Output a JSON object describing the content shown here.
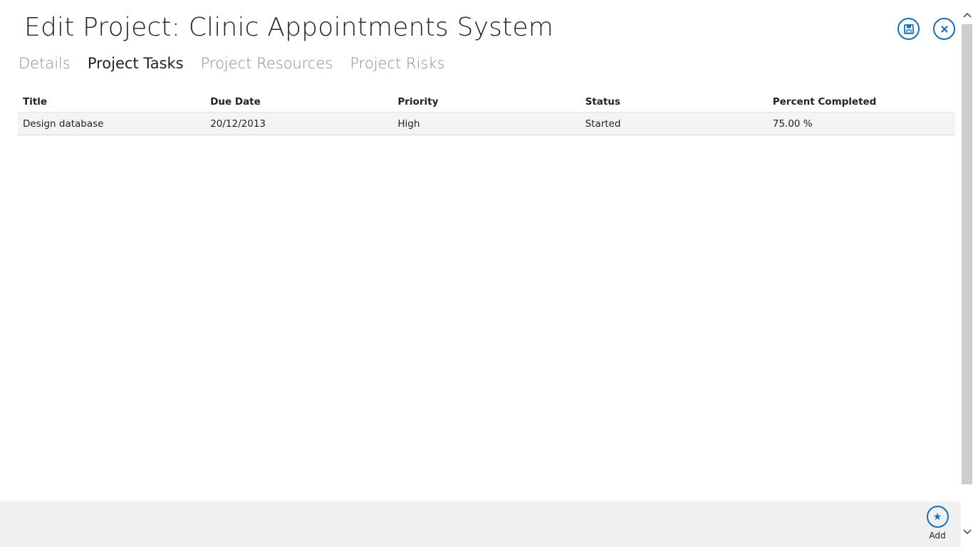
{
  "page": {
    "title": "Edit Project: Clinic Appointments System"
  },
  "header_actions": {
    "save_icon": "save-icon",
    "close_icon": "close-icon"
  },
  "tabs": [
    {
      "label": "Details",
      "active": false
    },
    {
      "label": "Project Tasks",
      "active": true
    },
    {
      "label": "Project Resources",
      "active": false
    },
    {
      "label": "Project Risks",
      "active": false
    }
  ],
  "table": {
    "columns": [
      "Title",
      "Due Date",
      "Priority",
      "Status",
      "Percent Completed"
    ],
    "rows": [
      [
        "Design database",
        "20/12/2013",
        "High",
        "Started",
        "75.00 %"
      ]
    ]
  },
  "app_bar": {
    "add": {
      "label": "Add",
      "icon": "star-icon",
      "glyph": "★"
    }
  },
  "colors": {
    "accent": "#1a6fb0",
    "app_bar_bg": "#f0f0f0",
    "row_bg": "#f4f4f4",
    "inactive_tab": "#8a8a8a"
  }
}
